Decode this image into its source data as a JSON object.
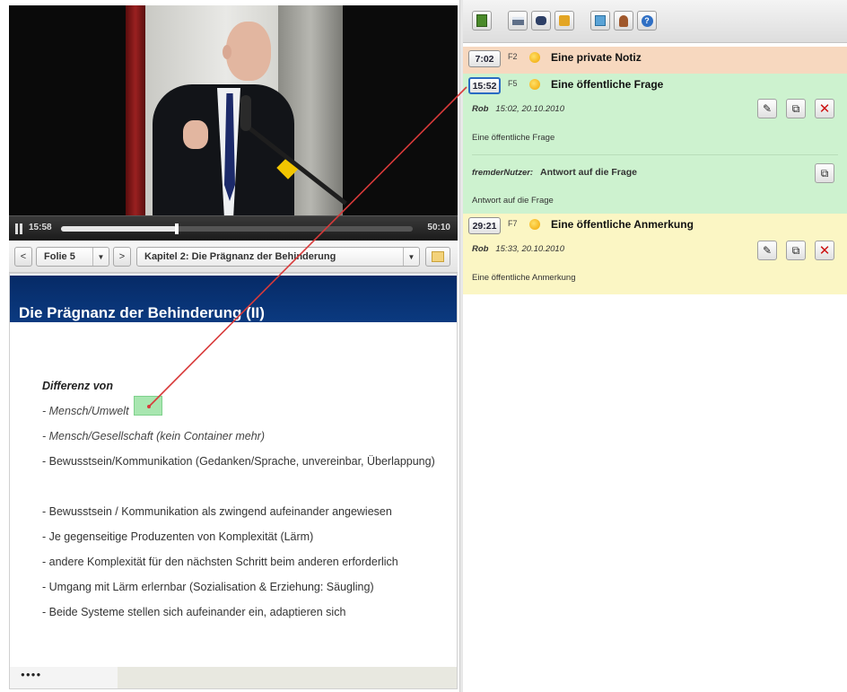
{
  "video": {
    "time_current": "15:58",
    "time_total": "50:10",
    "progress": 0.33
  },
  "slide_toolbar": {
    "prev_label": "<",
    "slide_select": "Folie 5",
    "next_label": ">",
    "chapter_select": "Kapitel 2: Die Prägnanz der Behinderung"
  },
  "slide": {
    "title": "Die Prägnanz der Behinderung (II)",
    "heading": "Differenz von",
    "lines": [
      "- Mensch/Umwelt",
      "- Mensch/Gesellschaft (kein Container mehr)",
      "- Bewusstsein/Kommunikation (Gedanken/Sprache, unvereinbar, Überlappung)",
      "- Bewusstsein / Kommunikation als zwingend aufeinander angewiesen",
      "- Je gegenseitige Produzenten von Komplexität (Lärm)",
      "- andere Komplexität für den nächsten Schritt beim anderen erforderlich",
      "- Umgang mit Lärm erlernbar (Sozialisation & Erziehung: Säugling)",
      "- Beide Systeme stellen sich aufeinander ein, adaptieren sich"
    ]
  },
  "notes": [
    {
      "time": "7:02",
      "slide_ref": "F2",
      "title": "Eine private Notiz"
    },
    {
      "time": "15:52",
      "slide_ref": "F5",
      "title": "Eine öffentliche Frage",
      "author": "Rob",
      "timestamp": "15:02, 20.10.2010",
      "body": "Eine öffentliche Frage",
      "reply": {
        "author": "fremderNutzer:",
        "title": "Antwort auf die Frage",
        "body": "Antwort auf die Frage"
      }
    },
    {
      "time": "29:21",
      "slide_ref": "F7",
      "title": "Eine öffentliche Anmerkung",
      "author": "Rob",
      "timestamp": "15:33, 20.10.2010",
      "body": "Eine öffentliche Anmerkung"
    }
  ],
  "colors": {
    "private_note": "#f7d8bf",
    "question_note": "#cdf2cf",
    "remark_note": "#fbf6c4",
    "slide_header": "#0b3a80",
    "connector": "#d83a3a"
  },
  "icons": {
    "toolbar": [
      "book-icon",
      "print-icon",
      "binoculars-icon",
      "download-icon",
      "export-icon",
      "user-icon",
      "help-icon"
    ],
    "note_actions": [
      "edit-icon",
      "reply-icon",
      "delete-icon"
    ]
  }
}
